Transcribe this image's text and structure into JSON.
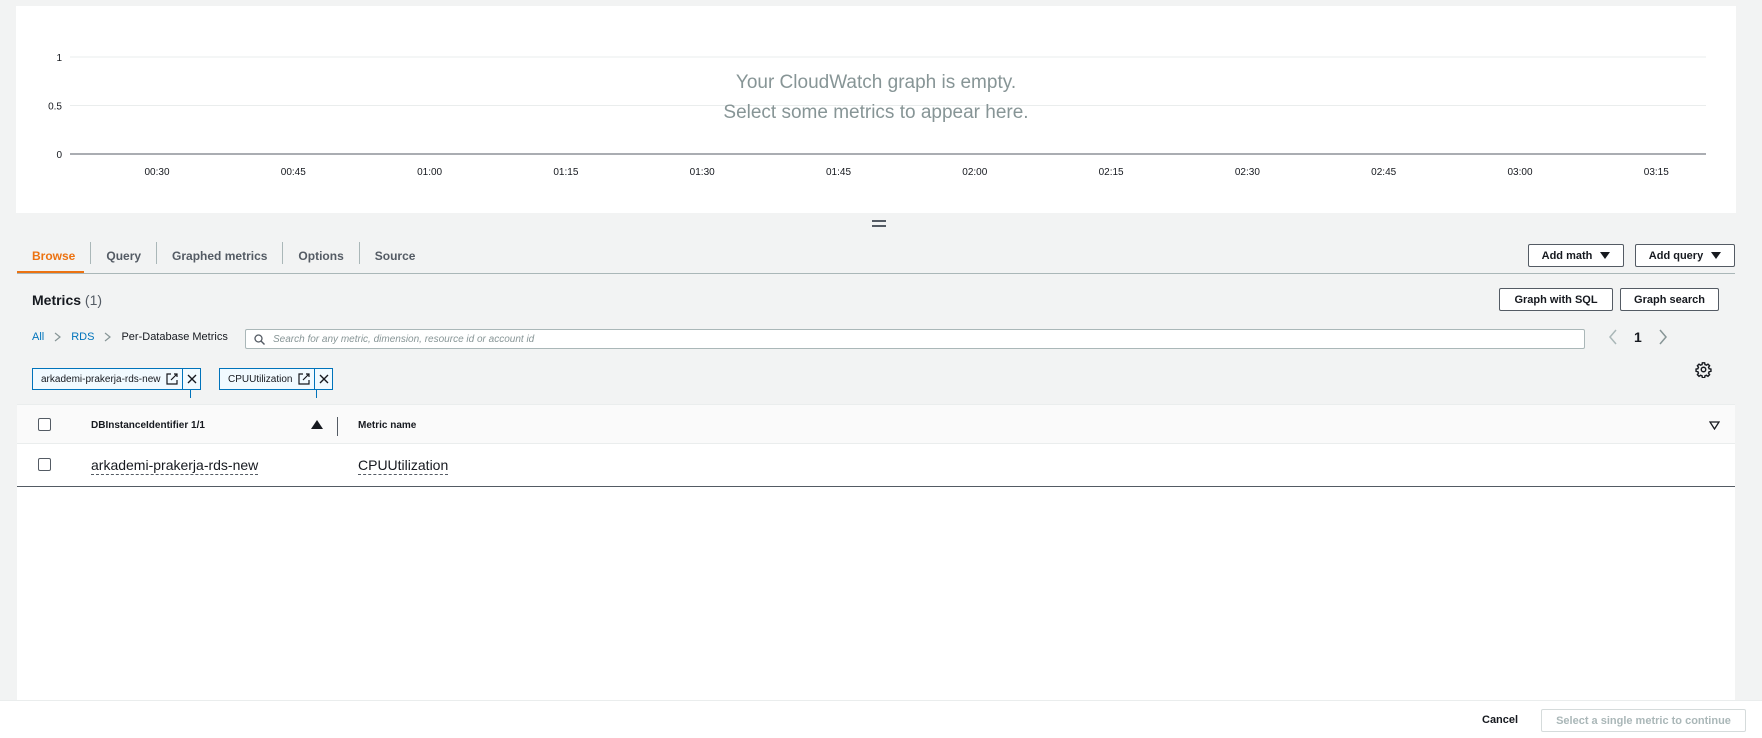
{
  "graph": {
    "empty_line1": "Your CloudWatch graph is empty.",
    "empty_line2": "Select some metrics to appear here.",
    "y_ticks": [
      "1",
      "0.5",
      "0"
    ],
    "x_ticks": [
      "00:30",
      "00:45",
      "01:00",
      "01:15",
      "01:30",
      "01:45",
      "02:00",
      "02:15",
      "02:30",
      "02:45",
      "03:00",
      "03:15"
    ]
  },
  "tabs": [
    {
      "label": "Browse",
      "active": true
    },
    {
      "label": "Query"
    },
    {
      "label": "Graphed metrics"
    },
    {
      "label": "Options"
    },
    {
      "label": "Source"
    }
  ],
  "toolbar": {
    "add_math": "Add math",
    "add_query": "Add query",
    "graph_with_sql": "Graph with SQL",
    "graph_search": "Graph search"
  },
  "metrics": {
    "title": "Metrics",
    "count": "(1)"
  },
  "breadcrumb": [
    "All",
    "RDS",
    "Per-Database Metrics"
  ],
  "search": {
    "placeholder": "Search for any metric, dimension, resource id or account id",
    "value": ""
  },
  "pagination": {
    "current_page": "1"
  },
  "tokens": [
    "arkademi-prakerja-rds-new",
    "CPUUtilization"
  ],
  "table": {
    "columns": [
      "DBInstanceIdentifier 1/1",
      "Metric name"
    ],
    "rows": [
      {
        "instance": "arkademi-prakerja-rds-new",
        "metric": "CPUUtilization"
      }
    ]
  },
  "footer": {
    "cancel": "Cancel",
    "continue": "Select a single metric to continue"
  },
  "colors": {
    "accent": "#ec7211",
    "link": "#0073bb"
  }
}
